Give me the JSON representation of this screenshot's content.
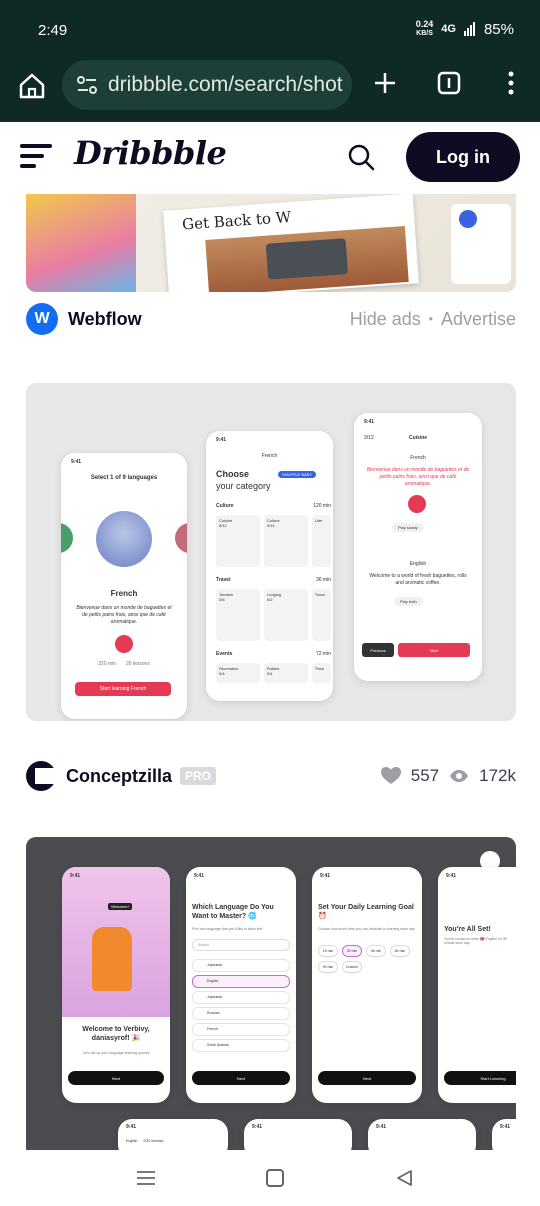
{
  "status_bar": {
    "time": "2:49",
    "speed_value": "0.24",
    "speed_unit": "KB/S",
    "network": "4G",
    "battery": "85%"
  },
  "browser": {
    "url": "dribbble.com/search/shot",
    "icons": [
      "home-icon",
      "site-settings-icon",
      "plus-icon",
      "tab-switcher-icon",
      "more-vert-icon"
    ]
  },
  "header": {
    "logo": "Dribbble",
    "login_label": "Log in"
  },
  "ad": {
    "brand": "Webflow",
    "brand_initial": "W",
    "hide_label": "Hide ads",
    "separator": "•",
    "advertise_label": "Advertise",
    "image_text": "Get Back to W"
  },
  "shot2": {
    "author": "Conceptzilla",
    "badge": "PRO",
    "likes": "557",
    "views": "172k",
    "phone1": {
      "time": "9:41",
      "title": "Select 1 of 9 languages",
      "language": "French",
      "body": "Bienvenue dans un monde de baguettes et de petits pains frais, ainsi que de café aromatique.",
      "min": "320 min",
      "lessons": "26 lessons",
      "cta": "Start learning French"
    },
    "phone2": {
      "time": "9:41",
      "lang": "French",
      "heading1": "Choose",
      "heading2": "your category",
      "shuffle": "SHUFFLE BABY",
      "sections": [
        {
          "name": "Culture",
          "time": "120 min",
          "items": [
            "Cuisine",
            "Culture",
            "Liter"
          ],
          "counts": [
            "8/12",
            "0/14",
            "0"
          ]
        },
        {
          "name": "Travel",
          "time": "36 min",
          "items": [
            "Tourism",
            "Lodging",
            "Trans"
          ],
          "counts": [
            "0/6",
            "0/2",
            "0"
          ]
        },
        {
          "name": "Events",
          "time": "72 min",
          "items": [
            "Recreation",
            "Parties",
            "Thea"
          ],
          "counts": [
            "0/4",
            "0/4",
            "0"
          ]
        }
      ]
    },
    "phone3": {
      "time": "9:41",
      "progress": "3/12",
      "category": "Cuisine",
      "lang1": "French",
      "french_text": "Bienvenue dans un monde de baguettes et de petits pains frais, ainsi que de café aromatique.",
      "play_slowly": "Play slowly",
      "lang2": "English",
      "english_text": "Welcome to a world of fresh baguettes, rolls and aromatic coffee.",
      "play_both": "Play both",
      "previous": "Previous",
      "next": "Next"
    }
  },
  "shot3": {
    "p1": {
      "time": "9:41",
      "badge": "Welcome!",
      "title": "Welcome to Verbivy, daniasyrof! 🎉",
      "sub": "Let's set up your language learning journey",
      "cta": "Next"
    },
    "p2": {
      "time": "9:41",
      "title": "Which Language Do You Want to Master? 🌐",
      "sub": "Pick one language that you'd like to learn first",
      "search": "Search",
      "langs": [
        "Japanese",
        "English",
        "Japanese",
        "Russian",
        "French",
        "South Arabian"
      ],
      "cta": "Next"
    },
    "p3": {
      "time": "9:41",
      "title": "Set Your Daily Learning Goal ⏰",
      "sub": "Choose how much time you can dedicate to learning each day.",
      "opts": [
        "15 min",
        "30 min",
        "45 min",
        "60 min",
        "90 min",
        "Custom"
      ],
      "cta": "Next"
    },
    "p4": {
      "time": "9:41",
      "title": "You're All Set!",
      "sub": "You've chosen to learn 🇬🇧 English for 30 minute each day.",
      "cta": "Start Learning"
    },
    "bottom": {
      "time": "9:41",
      "lang": "English",
      "dur": "0/30 minutes"
    }
  }
}
